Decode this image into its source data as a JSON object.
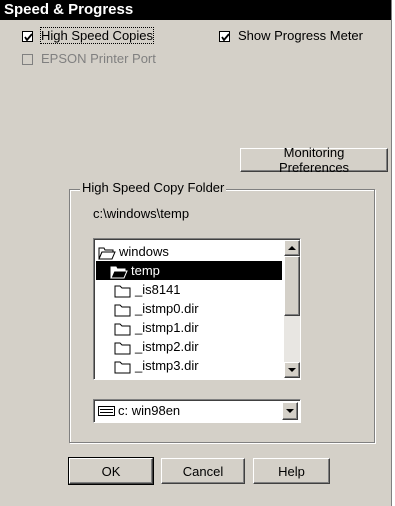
{
  "title": "Speed & Progress",
  "options": {
    "high_speed_copies": {
      "label": "High Speed Copies",
      "checked": true
    },
    "show_progress_meter": {
      "label": "Show Progress Meter",
      "checked": true
    },
    "epson_printer_port": {
      "label": "EPSON Printer Port",
      "checked": false,
      "disabled": true
    }
  },
  "monitoring_button": "Monitoring Preferences",
  "folder_group": {
    "title": "High Speed Copy Folder",
    "current_path": "c:\\windows\\temp",
    "folders": [
      {
        "name": "windows",
        "icon": "open-folder-icon",
        "selected": false
      },
      {
        "name": "temp",
        "icon": "open-folder-icon",
        "selected": true
      },
      {
        "name": "_is8141",
        "icon": "folder-icon",
        "selected": false
      },
      {
        "name": "_istmp0.dir",
        "icon": "folder-icon",
        "selected": false
      },
      {
        "name": "_istmp1.dir",
        "icon": "folder-icon",
        "selected": false
      },
      {
        "name": "_istmp2.dir",
        "icon": "folder-icon",
        "selected": false
      },
      {
        "name": "_istmp3.dir",
        "icon": "folder-icon",
        "selected": false
      }
    ],
    "drive": "c:  win98en"
  },
  "buttons": {
    "ok": "OK",
    "cancel": "Cancel",
    "help": "Help"
  }
}
